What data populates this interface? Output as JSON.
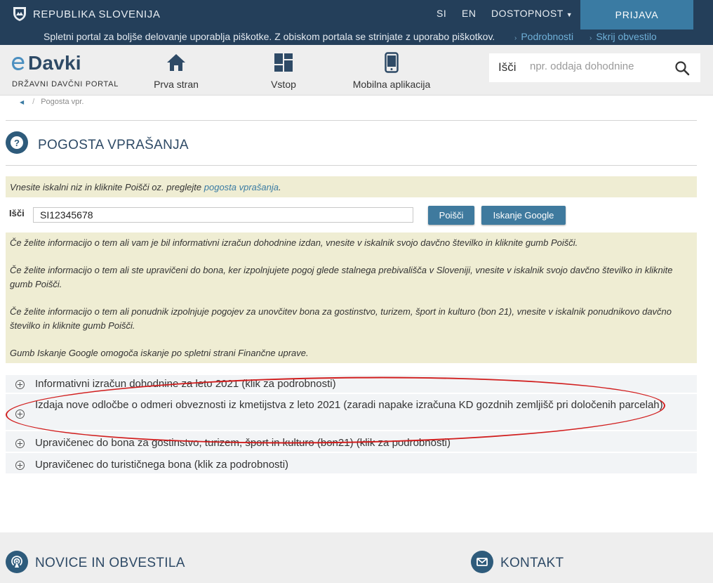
{
  "topbar": {
    "gov_name": "REPUBLIKA SLOVENIJA",
    "lang_si": "SI",
    "lang_en": "EN",
    "accessibility": "DOSTOPNOST",
    "login": "PRIJAVA"
  },
  "cookie_bar": {
    "text": "Spletni portal za boljše delovanje uporablja piškotke. Z obiskom portala se strinjate z uporabo piškotkov.",
    "details": "Podrobnosti",
    "hide": "Skrij obvestilo"
  },
  "header": {
    "logo": "Davki",
    "logo_sub": "DRŽAVNI DAVČNI PORTAL",
    "nav": [
      {
        "label": "Prva stran",
        "icon": "home-icon"
      },
      {
        "label": "Vstop",
        "icon": "dashboard-icon"
      },
      {
        "label": "Mobilna aplikacija",
        "icon": "mobile-phone-icon"
      }
    ],
    "search_label": "Išči",
    "search_placeholder": "npr. oddaja dohodnine"
  },
  "breadcrumb": {
    "current": "Pogosta vpr."
  },
  "page": {
    "title": "POGOSTA VPRAŠANJA",
    "hint_text": "Vnesite iskalni niz in kliknite Poišči oz. preglejte ",
    "hint_link": "pogosta vprašanja",
    "hint_end": "."
  },
  "search": {
    "label": "Išči",
    "value": "SI12345678",
    "search_button": "Poišči",
    "google_button": "Iskanje Google"
  },
  "info": [
    "Če želite informacijo o tem ali vam je bil informativni izračun dohodnine izdan, vnesite v iskalnik svojo davčno številko in kliknite gumb Poišči.",
    "Če želite informacijo o tem ali ste upravičeni do bona, ker izpolnjujete pogoj glede stalnega prebivališča v Sloveniji, vnesite v iskalnik svojo davčno številko in kliknite gumb Poišči.",
    "Če želite informacijo o tem ali ponudnik izpolnjuje pogojev za unovčitev bona za gostinstvo, turizem, šport in kulturo (bon 21), vnesite v iskalnik ponudnikovo davčno številko in kliknite gumb Poišči.",
    "Gumb Iskanje Google omogoča iskanje po spletni strani Finančne uprave."
  ],
  "faq": [
    "Informativni izračun dohodnine za leto 2021 (klik za podrobnosti)",
    "Izdaja nove odločbe o odmeri obveznosti iz kmetijstva z leto 2021 (zaradi napake izračuna KD gozdnih zemljišč pri določenih parcelah)",
    "Upravičenec do bona za gostinstvo, turizem, šport in kulturo (bon21) (klik za podrobnosti)",
    "Upravičenec do turističnega bona (klik za podrobnosti)"
  ],
  "bottom": {
    "news": "NOVICE IN OBVESTILA",
    "contact": "KONTAKT"
  },
  "colors": {
    "topbar": "#243f5a",
    "accent": "#3a7ba3",
    "notice_bg": "#efedd3",
    "annotation": "#d11e1e"
  }
}
